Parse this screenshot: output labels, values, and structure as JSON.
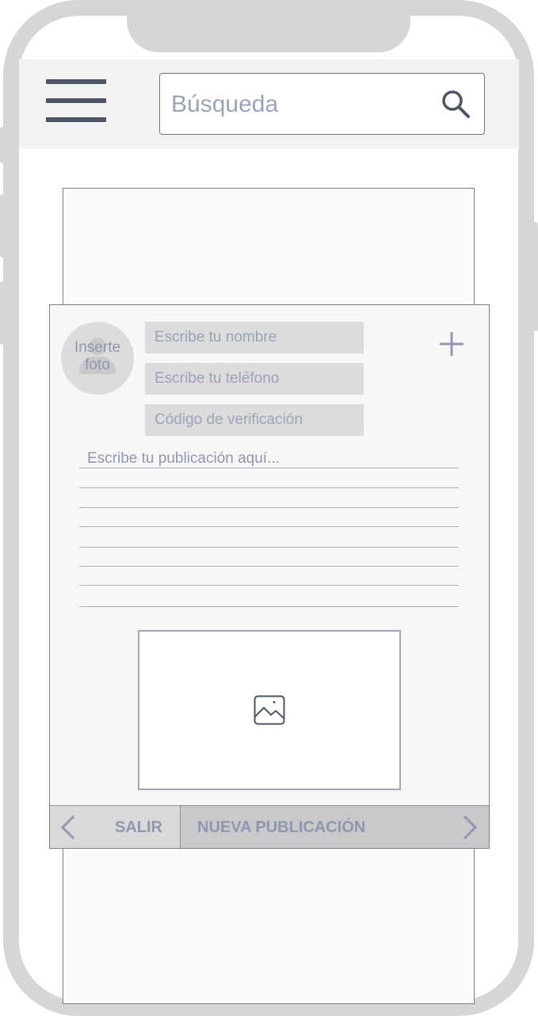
{
  "header": {
    "search": {
      "placeholder": "Búsqueda"
    }
  },
  "form": {
    "avatar_label": "Inserte foto",
    "name_placeholder": "Escribe tu nombre",
    "phone_placeholder": "Escribe tu teléfono",
    "code_placeholder": "Código de verificación",
    "post_placeholder": "Escribe tu publicación aquí..."
  },
  "actions": {
    "exit_label": "SALIR",
    "new_post_label": "NUEVA PUBLICACIÓN"
  },
  "colors": {
    "frame": "#d6d6d6",
    "icon": "#4b5563",
    "placeholder_text": "#9aa3b8"
  }
}
